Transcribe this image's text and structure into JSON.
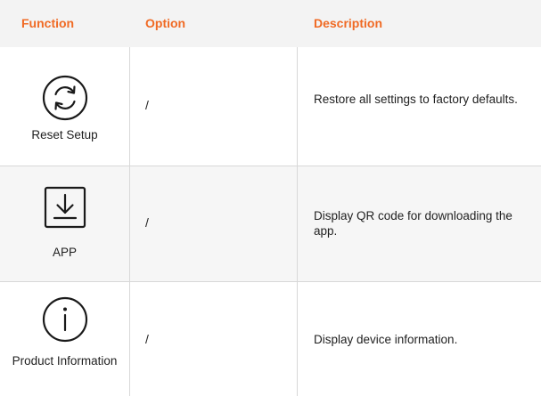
{
  "header": {
    "function": "Function",
    "option": "Option",
    "description": "Description"
  },
  "rows": [
    {
      "icon": "reset-refresh-icon",
      "function": "Reset Setup",
      "option": "/",
      "description": "Restore all settings to factory defaults."
    },
    {
      "icon": "download-icon",
      "function": "APP",
      "option": "/",
      "description": "Display QR code for downloading the app."
    },
    {
      "icon": "info-icon",
      "function": "Product Information",
      "option": "/",
      "description": "Display device information."
    }
  ],
  "colors": {
    "header_text": "#f06a24",
    "header_bg": "#f3f3f3",
    "shaded_row_bg": "#f6f6f6"
  }
}
